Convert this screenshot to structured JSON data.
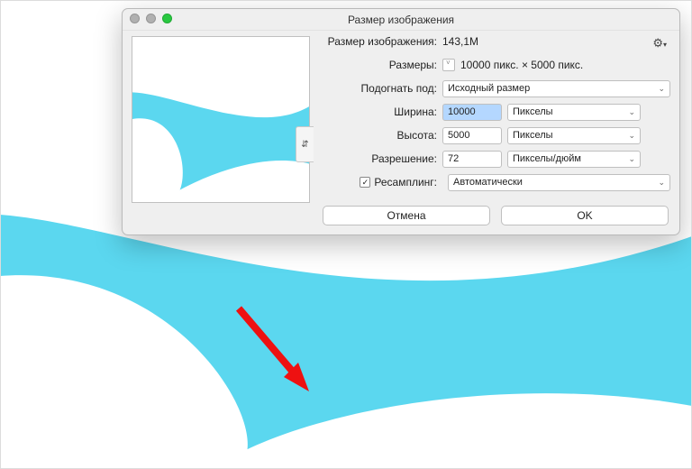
{
  "dialog": {
    "title": "Размер изображения",
    "sizeLabel": "Размер изображения:",
    "sizeValue": "143,1M",
    "dimsLabel": "Размеры:",
    "dimsValue": "10000 пикс. × 5000 пикс.",
    "fitLabel": "Подогнать под:",
    "fitValue": "Исходный размер",
    "widthLabel": "Ширина:",
    "widthValue": "10000",
    "heightLabel": "Высота:",
    "heightValue": "5000",
    "unitPixels": "Пикселы",
    "resLabel": "Разрешение:",
    "resValue": "72",
    "resUnit": "Пикселы/дюйм",
    "resampleLabel": "Ресамплинг:",
    "resampleValue": "Автоматически",
    "cancel": "Отмена",
    "ok": "OK"
  }
}
